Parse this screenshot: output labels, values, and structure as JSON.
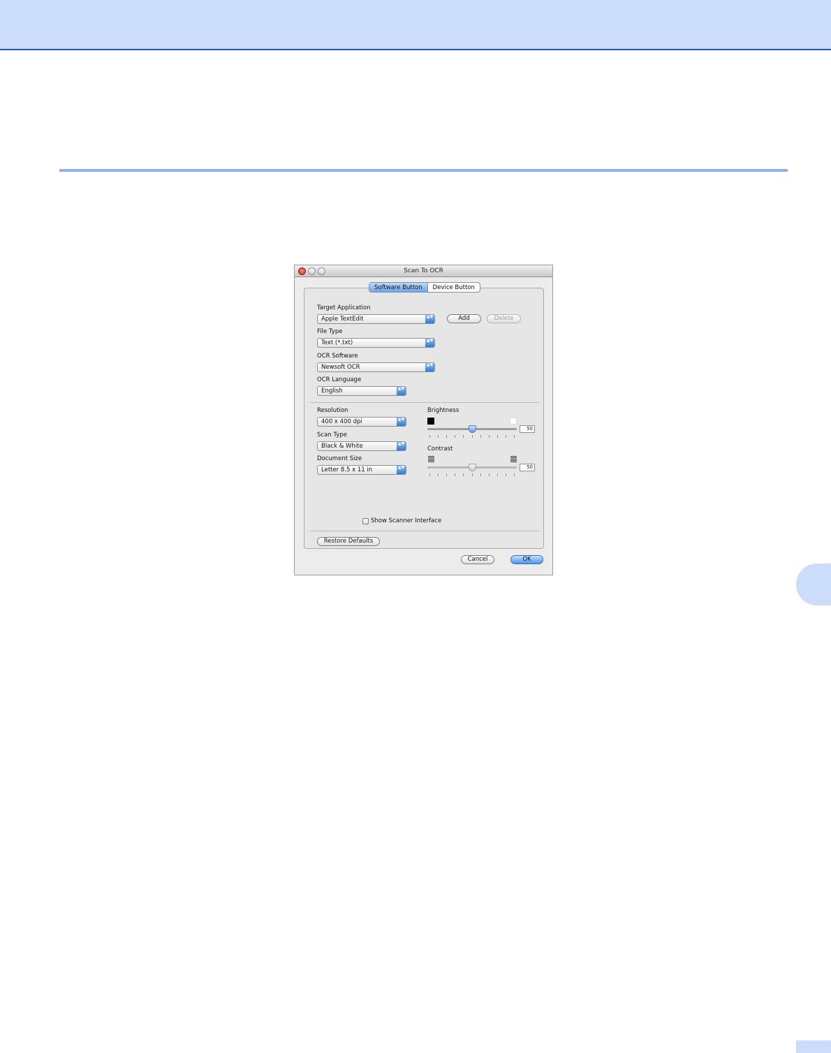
{
  "dialog": {
    "title": "Scan To OCR",
    "tabs": [
      {
        "label": "Software Button",
        "active": true
      },
      {
        "label": "Device Button",
        "active": false
      }
    ],
    "target_application": {
      "label": "Target Application",
      "value": "Apple TextEdit",
      "add_label": "Add",
      "delete_label": "Delete"
    },
    "file_type": {
      "label": "File Type",
      "value": "Text (*.txt)"
    },
    "ocr_software": {
      "label": "OCR Software",
      "value": "Newsoft OCR"
    },
    "ocr_language": {
      "label": "OCR Language",
      "value": "English"
    },
    "resolution": {
      "label": "Resolution",
      "value": "400 x 400 dpi"
    },
    "scan_type": {
      "label": "Scan Type",
      "value": "Black & White"
    },
    "document_size": {
      "label": "Document Size",
      "value": "Letter  8.5 x 11 in"
    },
    "brightness": {
      "label": "Brightness",
      "value": "50",
      "level": 0.5,
      "enabled": true
    },
    "contrast": {
      "label": "Contrast",
      "value": "50",
      "level": 0.5,
      "enabled": false
    },
    "show_scanner_interface": {
      "label": "Show Scanner Interface",
      "checked": false
    },
    "restore_defaults_label": "Restore Defaults",
    "cancel_label": "Cancel",
    "ok_label": "OK",
    "popup_arrow_glyph": "▲▼"
  },
  "colors": {
    "header_band": "#ccdcfb",
    "header_rule": "#1f56c9",
    "accent_blue": "#4c94ec"
  }
}
